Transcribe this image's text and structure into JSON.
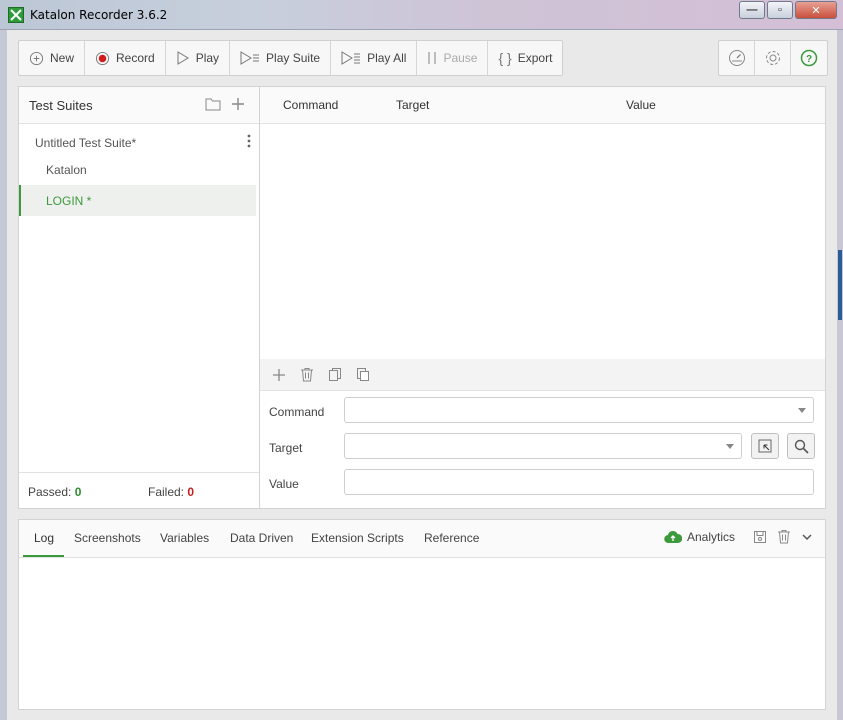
{
  "window": {
    "title": "Katalon Recorder 3.6.2",
    "minimize_label": "—",
    "maximize_label": "▫",
    "close_label": "✕"
  },
  "toolbar": {
    "new_label": "New",
    "record_label": "Record",
    "play_label": "Play",
    "play_suite_label": "Play Suite",
    "play_all_label": "Play All",
    "pause_label": "Pause",
    "export_label": "Export"
  },
  "left_panel": {
    "title": "Test Suites",
    "suite_name": "Untitled Test Suite*",
    "test_cases": [
      {
        "label": "Katalon",
        "selected": false
      },
      {
        "label": "LOGIN *",
        "selected": true
      }
    ],
    "passed_label": "Passed:",
    "passed_count": "0",
    "failed_label": "Failed:",
    "failed_count": "0"
  },
  "command_table": {
    "col_command": "Command",
    "col_target": "Target",
    "col_value": "Value"
  },
  "editor": {
    "command_label": "Command",
    "target_label": "Target",
    "value_label": "Value"
  },
  "bottom_panel": {
    "tabs": [
      "Log",
      "Screenshots",
      "Variables",
      "Data Driven",
      "Extension Scripts",
      "Reference"
    ],
    "active_tab": "Log",
    "analytics_label": "Analytics"
  },
  "colors": {
    "accent_green": "#3c9a3c",
    "record_red": "#d11a1a",
    "failed_red": "#c41e1e"
  }
}
